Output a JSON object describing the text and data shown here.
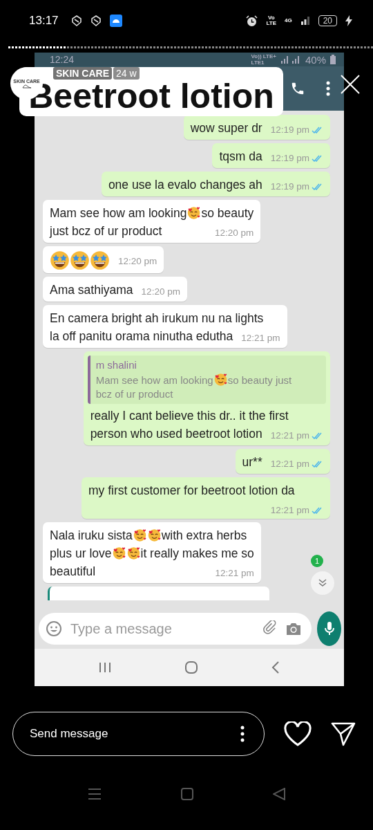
{
  "status_bar": {
    "time": "13:17",
    "volte_top": "Vo",
    "volte_bottom": "LTE",
    "network": "4G",
    "battery": "20"
  },
  "story": {
    "level": 0.16
  },
  "author": {
    "logo_text": "SKIN CARE",
    "name": "SKIN CARE",
    "age": "24 w"
  },
  "sticker": {
    "text": "Beetroot lotion"
  },
  "screenshot": {
    "status_bar": {
      "time": "12:24",
      "network_top": "Vo)) LTE+",
      "network_bottom": "LTE1",
      "battery": "40%"
    },
    "messages": [
      {
        "kind": "outgoing",
        "segments": [
          {
            "kind": "text",
            "text": "wow super dr"
          }
        ],
        "time": "12:19 pm"
      },
      {
        "kind": "outgoing",
        "segments": [
          {
            "kind": "text",
            "text": "tqsm da"
          }
        ],
        "time": "12:19 pm"
      },
      {
        "kind": "outgoing",
        "segments": [
          {
            "kind": "text",
            "text": "one use la evalo changes ah"
          }
        ],
        "time": "12:19 pm"
      },
      {
        "kind": "incoming",
        "segments": [
          {
            "kind": "text",
            "text": "Mam see how am looking"
          },
          {
            "kind": "heart-face"
          },
          {
            "kind": "text",
            "text": "so beauty"
          },
          {
            "kind": "break"
          },
          {
            "kind": "text",
            "text": "just bcz of ur product"
          }
        ],
        "time": "12:20 pm"
      },
      {
        "kind": "incoming",
        "segments": [
          {
            "kind": "star-face"
          },
          {
            "kind": "star-face"
          },
          {
            "kind": "star-face"
          }
        ],
        "time": "12:20 pm"
      },
      {
        "kind": "incoming",
        "segments": [
          {
            "kind": "text",
            "text": "Ama sathiyama"
          }
        ],
        "time": "12:20 pm"
      },
      {
        "kind": "incoming",
        "segments": [
          {
            "kind": "text",
            "text": "En camera bright ah irukum nu na lights"
          },
          {
            "kind": "break"
          },
          {
            "kind": "text",
            "text": "la off panitu orama ninutha edutha"
          }
        ],
        "time": "12:21 pm"
      },
      {
        "kind": "outgoing",
        "quote": {
          "author": "m shalini",
          "segments": [
            {
              "kind": "text",
              "text": "Mam see how am looking"
            },
            {
              "kind": "heart-face"
            },
            {
              "kind": "text",
              "text": "so beauty just"
            },
            {
              "kind": "break"
            },
            {
              "kind": "text",
              "text": "bcz of ur product"
            }
          ]
        },
        "segments": [
          {
            "kind": "text",
            "text": "really I cant believe this dr.. it the first"
          },
          {
            "kind": "break"
          },
          {
            "kind": "text",
            "text": "person who used beetroot lotion"
          }
        ],
        "time": "12:21 pm"
      },
      {
        "kind": "outgoing",
        "segments": [
          {
            "kind": "text",
            "text": "ur**"
          }
        ],
        "time": "12:21 pm"
      },
      {
        "kind": "outgoing",
        "segments": [
          {
            "kind": "text",
            "text": "my first customer for beetroot lotion da"
          }
        ],
        "time": "12:21 pm"
      },
      {
        "kind": "incoming",
        "segments": [
          {
            "kind": "text",
            "text": "Nala iruku sista"
          },
          {
            "kind": "heart-face"
          },
          {
            "kind": "heart-face"
          },
          {
            "kind": "text",
            "text": "with extra herbs"
          },
          {
            "kind": "break"
          },
          {
            "kind": "text",
            "text": "plus ur love"
          },
          {
            "kind": "heart-face"
          },
          {
            "kind": "heart-face"
          },
          {
            "kind": "text",
            "text": "it really makes me so"
          },
          {
            "kind": "break"
          },
          {
            "kind": "text",
            "text": "beautiful"
          }
        ],
        "time": "12:21 pm"
      },
      {
        "kind": "partial"
      }
    ],
    "unread_count": "1",
    "input": {
      "placeholder": "Type a message"
    }
  },
  "reply": {
    "placeholder": "Send message"
  }
}
